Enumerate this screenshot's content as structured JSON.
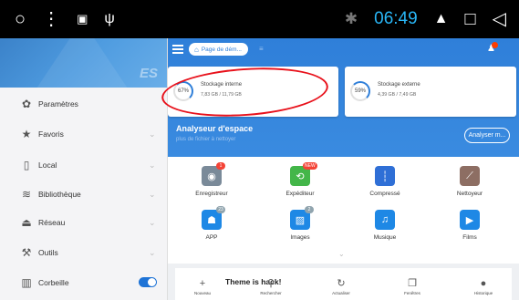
{
  "status_bar": {
    "time": "06:49",
    "icons": [
      "circle-icon",
      "more-vert-icon",
      "image-icon",
      "usb-icon",
      "bluetooth-icon",
      "eject-icon",
      "square-icon",
      "back-icon"
    ]
  },
  "drawer": {
    "logo_text": "ES",
    "items": [
      {
        "label": "Paramètres",
        "icon": "gear-icon"
      },
      {
        "label": "Favoris",
        "icon": "star-icon"
      },
      {
        "label": "Local",
        "icon": "phone-icon"
      },
      {
        "label": "Bibliothèque",
        "icon": "layers-icon"
      },
      {
        "label": "Réseau",
        "icon": "network-icon"
      },
      {
        "label": "Outils",
        "icon": "wrench-icon"
      },
      {
        "label": "Corbeille",
        "icon": "trash-icon",
        "toggle_on": true
      }
    ]
  },
  "main": {
    "path_label": "Page de dém...",
    "storage": {
      "internal": {
        "percent": "67%",
        "title": "Stockage interne",
        "size": "7,83 GB / 11,79 GB",
        "fill": 0.67
      },
      "external": {
        "percent": "59%",
        "title": "Stockage externe",
        "size": "4,39 GB / 7,49 GB",
        "fill": 0.59
      }
    },
    "analyzer": {
      "title": "Analyseur d'espace",
      "subtitle": "plus de fichier à nettoyer",
      "button": "Analyser m..."
    },
    "tiles": [
      {
        "label": "Enregistreur",
        "icon": "recorder-icon",
        "color": "#7a8a99",
        "badge": "1",
        "badge_color": "#f44336"
      },
      {
        "label": "Expéditeur",
        "icon": "sender-icon",
        "color": "#43b649",
        "badge": "NEW",
        "badge_color": "#f44336"
      },
      {
        "label": "Compressé",
        "icon": "zip-icon",
        "color": "#2f6fd6",
        "badge": "",
        "badge_color": ""
      },
      {
        "label": "Nettoyeur",
        "icon": "broom-icon",
        "color": "#8d6e63",
        "badge": "",
        "badge_color": ""
      },
      {
        "label": "APP",
        "icon": "android-icon",
        "color": "#1e88e5",
        "badge": "23",
        "badge_color": "#90a4ae"
      },
      {
        "label": "Images",
        "icon": "images-icon",
        "color": "#1e88e5",
        "badge": "2",
        "badge_color": "#90a4ae"
      },
      {
        "label": "Musique",
        "icon": "music-icon",
        "color": "#1e88e5",
        "badge": "",
        "badge_color": ""
      },
      {
        "label": "Films",
        "icon": "film-icon",
        "color": "#1e88e5",
        "badge": "",
        "badge_color": ""
      }
    ],
    "news_title": "Theme is hack!",
    "bottom_bar": [
      {
        "label": "Nouveau",
        "icon": "plus-icon"
      },
      {
        "label": "Rechercher",
        "icon": "search-icon"
      },
      {
        "label": "Actualiser",
        "icon": "refresh-icon"
      },
      {
        "label": "Fenêtres",
        "icon": "windows-icon"
      },
      {
        "label": "Historique",
        "icon": "history-icon"
      }
    ]
  },
  "colors": {
    "accent": "#2f7fd9",
    "annotation": "#e8111b",
    "clock": "#29b6f6"
  }
}
